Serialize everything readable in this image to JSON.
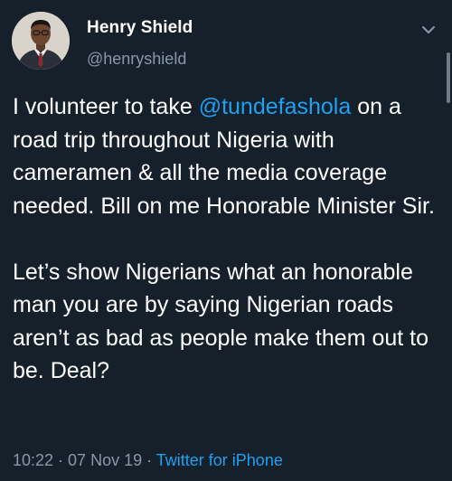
{
  "author": {
    "display_name": "Henry Shield",
    "handle": "@henryshield"
  },
  "tweet": {
    "para1_before": "I volunteer to take ",
    "mention": "@tundefashola",
    "para1_after": " on a road trip throughout Nigeria with cameramen & all the media coverage needed. Bill on me Honorable Minister Sir.",
    "para2": "Let’s show Nigerians what an honorable man you are by saying Nigerian roads aren’t as bad as people make them out to be. Deal?"
  },
  "meta": {
    "time": "10:22",
    "separator1": " · ",
    "date": "07 Nov 19",
    "separator2": " · ",
    "source": "Twitter for iPhone"
  },
  "icons": {
    "caret": "chevron-down-icon"
  },
  "colors": {
    "background": "#15202b",
    "text": "#ffffff",
    "secondary_text": "#8899a6",
    "link": "#1da1f2"
  }
}
